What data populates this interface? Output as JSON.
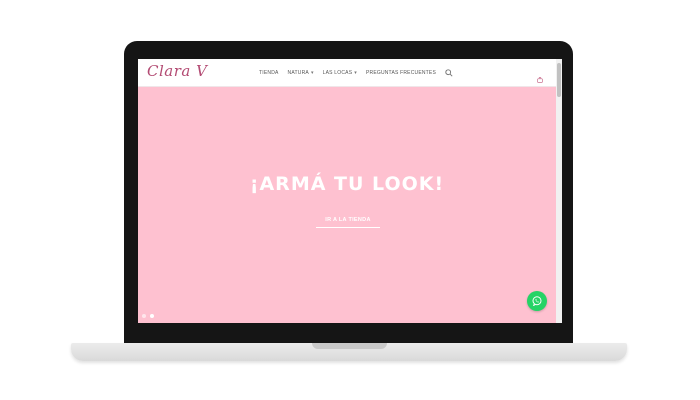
{
  "header": {
    "logo_text": "Clara V",
    "nav": [
      {
        "label": "TIENDA",
        "has_dropdown": false
      },
      {
        "label": "NATURA",
        "has_dropdown": true
      },
      {
        "label": "LAS LOCAS",
        "has_dropdown": true
      },
      {
        "label": "PREGUNTAS FRECUENTES",
        "has_dropdown": false
      }
    ],
    "search_icon": "search-icon",
    "cart_icon": "cart-icon"
  },
  "hero": {
    "title": "¡ARMÁ TU LOOK!",
    "button_label": "IR A LA TIENDA",
    "background_color": "#fec1d0",
    "slide_count": 2,
    "active_slide": 2
  },
  "whatsapp": {
    "icon": "whatsapp-icon",
    "color": "#25d366"
  },
  "colors": {
    "brand": "#b34b73",
    "accent": "#fec1d0"
  }
}
